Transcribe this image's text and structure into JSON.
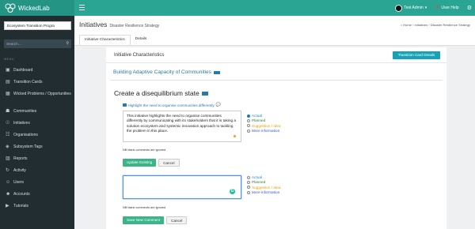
{
  "brand": {
    "name": "WickedLab"
  },
  "topbar": {
    "user": "Test Admin",
    "help": "User Help"
  },
  "sidebar": {
    "context_select": "Ecosystem Transition Progra",
    "search_placeholder": "Search...",
    "menu_header": "MENU",
    "items": [
      {
        "label": "Dashboard",
        "icon": "dashboard-icon",
        "glyph": "▣"
      },
      {
        "label": "Transition Cards",
        "icon": "cards-icon",
        "glyph": "▤"
      },
      {
        "label": "Wicked Problems / Opportunities",
        "icon": "problems-icon",
        "glyph": "▦"
      },
      {
        "label": "Communities",
        "icon": "communities-icon",
        "glyph": "☗"
      },
      {
        "label": "Initiatives",
        "icon": "initiatives-icon",
        "glyph": "☉"
      },
      {
        "label": "Organisations",
        "icon": "organisations-icon",
        "glyph": "☷"
      },
      {
        "label": "Subsystem Tags",
        "icon": "tags-icon",
        "glyph": "◈"
      },
      {
        "label": "Reports",
        "icon": "reports-icon",
        "glyph": "▥"
      },
      {
        "label": "Activity",
        "icon": "activity-icon",
        "glyph": "↻"
      },
      {
        "label": "Users",
        "icon": "users-icon",
        "glyph": "☺"
      },
      {
        "label": "Accounts",
        "icon": "accounts-icon",
        "glyph": "☻"
      },
      {
        "label": "Tutorials",
        "icon": "tutorials-icon",
        "glyph": "▶"
      }
    ]
  },
  "header": {
    "title": "Initiatives",
    "subtitle": "Disaster Resilience Strategy",
    "breadcrumb": [
      "Home",
      "Initiatives",
      "Disaster Resilience Strategy"
    ],
    "tabs": [
      "Initiative Characteristics",
      "Details"
    ]
  },
  "card": {
    "title": "Initiative Characteristics",
    "transition_button": "Transition Card Details",
    "section_title": "Building Adaptive Capacity of Communities",
    "heading": "Create a disequilibrium state",
    "checkbox_label": "Highlight the need to organise communities differently",
    "comment_text": "This initiative highlights the need to organise communities differently by communicating with its stakeholders that it is taking a solution ecosystem and systemic innovation approach to tackling the problem in this place.",
    "blank_note": "NB blank comments are ignored",
    "update_button": "Update Existing",
    "cancel_button": "Cancel",
    "save_button": "Save New Comment",
    "new_comment_value": "",
    "selected_option": "Actual",
    "options": [
      "Actual",
      "Planned",
      "Suggestion / Idea",
      "More information"
    ]
  },
  "colors": {
    "topbar": "#2aa594",
    "sidebar": "#222d32",
    "accent_blue": "#17a2b8",
    "button_green": "#3cb48a"
  }
}
